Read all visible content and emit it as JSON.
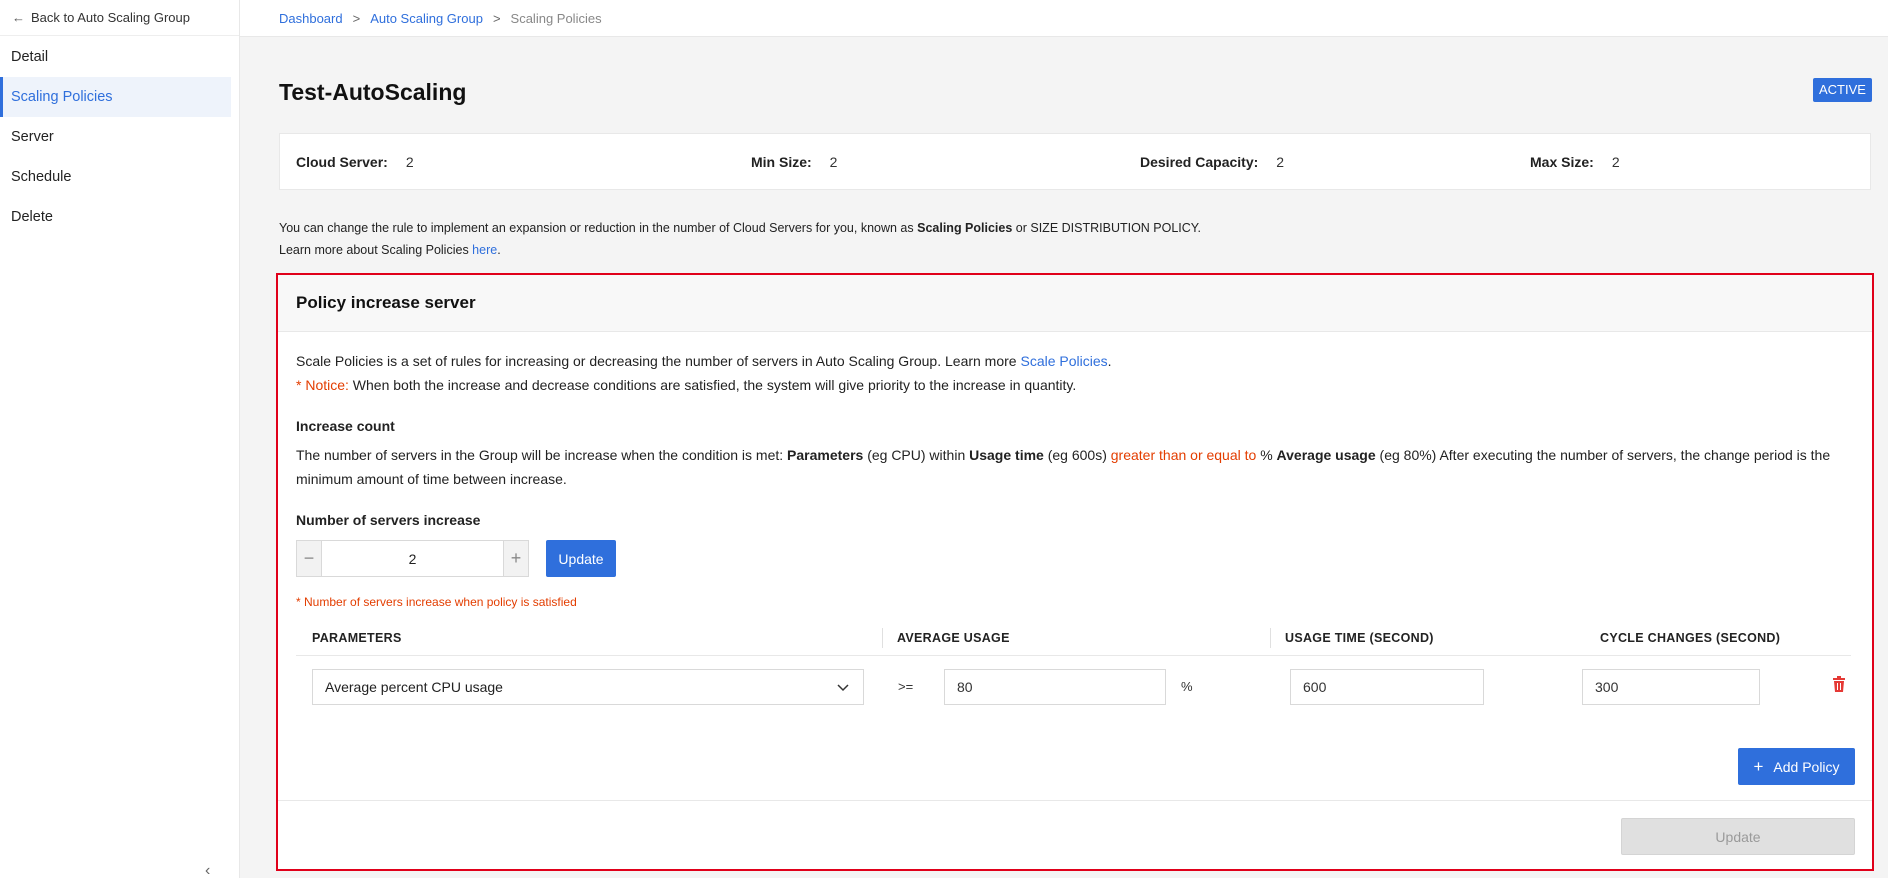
{
  "sidebar": {
    "back_label": "Back to Auto Scaling Group",
    "items": [
      {
        "label": "Detail"
      },
      {
        "label": "Scaling Policies"
      },
      {
        "label": "Server"
      },
      {
        "label": "Schedule"
      },
      {
        "label": "Delete"
      }
    ],
    "collapse_icon": "chevron-left-icon"
  },
  "breadcrumb": {
    "items": [
      "Dashboard",
      "Auto Scaling Group",
      "Scaling Policies"
    ],
    "separator": ">"
  },
  "page": {
    "title": "Test-AutoScaling",
    "status": "ACTIVE"
  },
  "summary": {
    "cloud_server_label": "Cloud Server:",
    "cloud_server_value": "2",
    "min_size_label": "Min Size:",
    "min_size_value": "2",
    "desired_capacity_label": "Desired Capacity:",
    "desired_capacity_value": "2",
    "max_size_label": "Max Size:",
    "max_size_value": "2"
  },
  "description": {
    "line1_pre": "You can change the rule to implement an expansion or reduction in the number of Cloud Servers for you, known as ",
    "line1_bold": "Scaling Policies",
    "line1_post": " or SIZE DISTRIBUTION POLICY.",
    "line2_pre": "Learn more about Scaling Policies ",
    "line2_link": "here",
    "line2_post": "."
  },
  "policy": {
    "title": "Policy increase server",
    "intro_pre": "Scale Policies is a set of rules for increasing or decreasing the number of servers in Auto Scaling Group. Learn more ",
    "intro_link": "Scale Policies",
    "intro_post": ".",
    "notice_label": "* Notice:",
    "notice_text": " When both the increase and decrease conditions are satisfied, the system will give priority to the increase in quantity.",
    "increase_count_title": "Increase count",
    "cond_1": "The number of servers in the Group will be increase when the condition is met: ",
    "cond_b1": "Parameters",
    "cond_2": " (eg CPU) within ",
    "cond_b2": "Usage time",
    "cond_3": " (eg 600s) ",
    "cond_red": "greater than or equal to",
    "cond_4": " % ",
    "cond_b3": "Average usage",
    "cond_5": " (eg 80%) After executing the number of servers, the change period is the minimum amount of time between increase.",
    "servers_increase_label": "Number of servers increase",
    "servers_increase_value": "2",
    "update_label": "Update",
    "hint": "* Number of servers increase when policy is satisfied",
    "table": {
      "headers": [
        "PARAMETERS",
        "AVERAGE USAGE",
        "USAGE TIME (SECOND)",
        "CYCLE CHANGES (SECOND)"
      ],
      "row": {
        "parameter": "Average percent CPU usage",
        "operator": ">=",
        "average_usage": "80",
        "unit": "%",
        "usage_time": "600",
        "cycle_changes": "300"
      }
    },
    "add_policy_label": "Add Policy",
    "footer_update_label": "Update"
  },
  "colors": {
    "accent": "#2f6fdc",
    "notice": "#e33d00",
    "highlight_border": "#e0001a",
    "delete_icon": "#e53935"
  }
}
